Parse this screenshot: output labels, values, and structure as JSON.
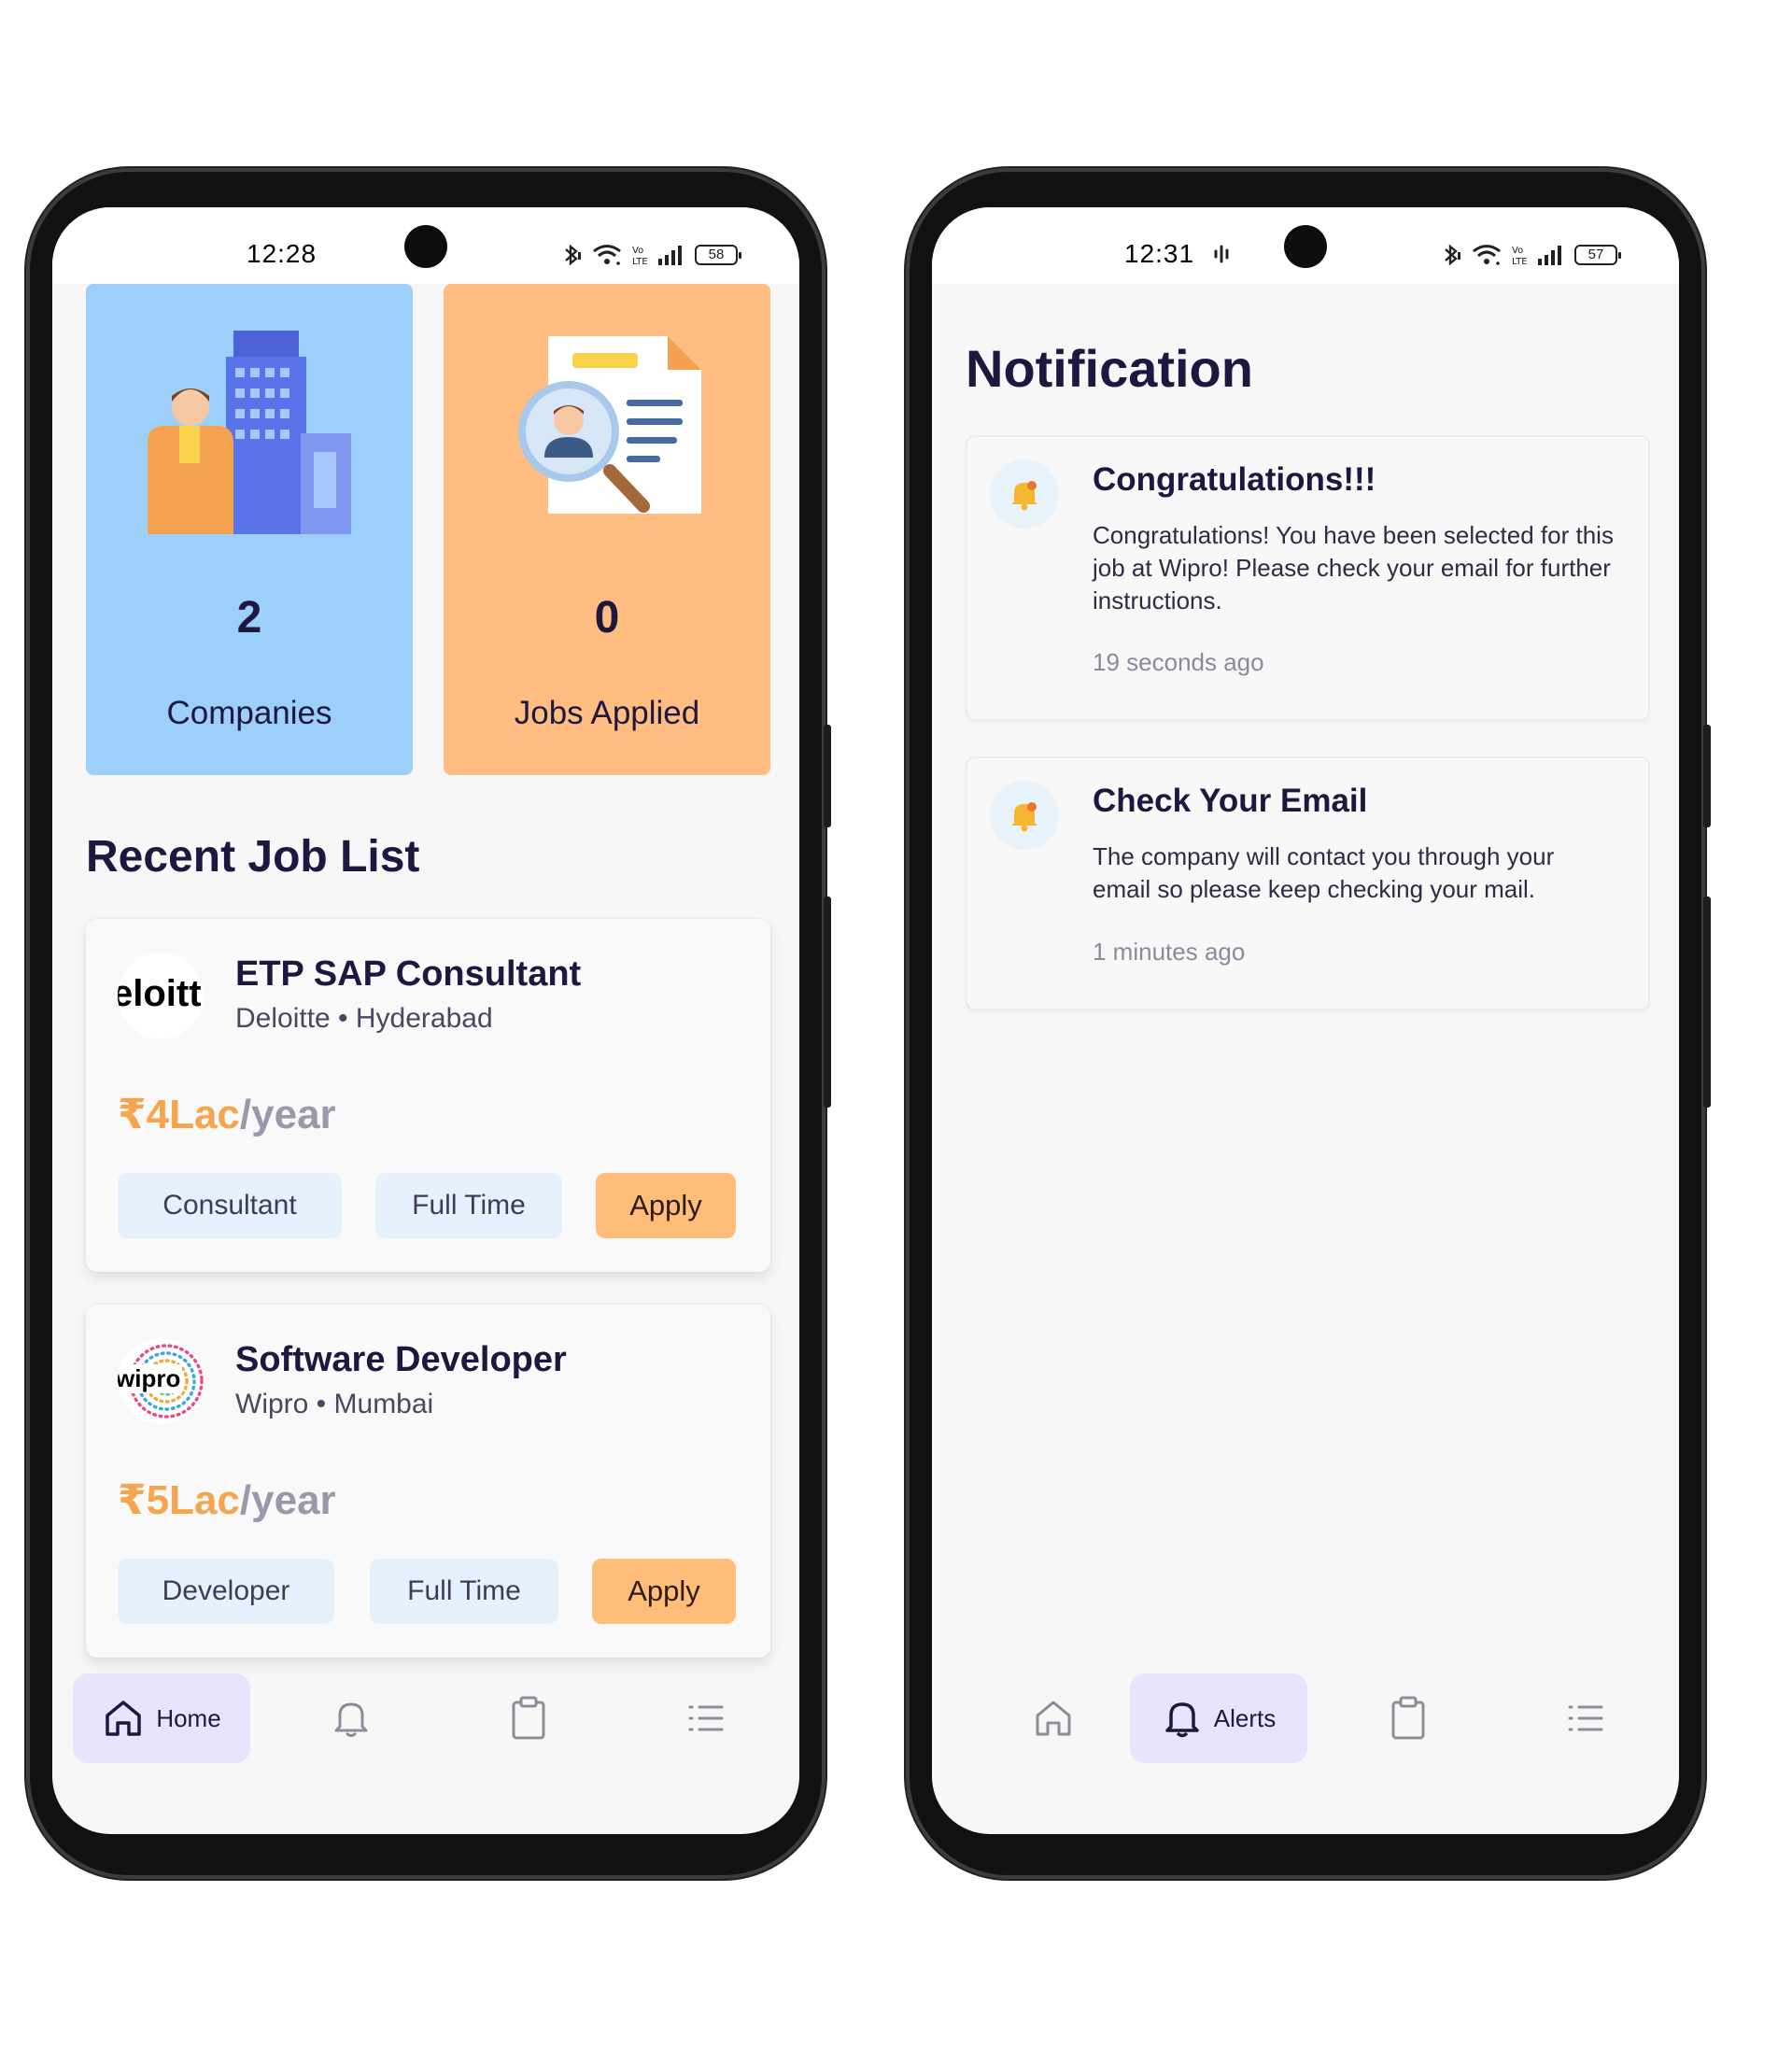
{
  "left_screen": {
    "status": {
      "time": "12:28",
      "battery": "58"
    },
    "stats": [
      {
        "number": "2",
        "label": "Companies"
      },
      {
        "number": "0",
        "label": "Jobs Applied"
      }
    ],
    "section_title": "Recent Job List",
    "jobs": [
      {
        "logo_text": "eloitt",
        "title": "ETP SAP Consultant",
        "meta": "Deloitte • Hyderabad",
        "salary_amount": "₹4Lac",
        "salary_period": "/year",
        "tags": [
          "Consultant",
          "Full Time"
        ],
        "apply_label": "Apply"
      },
      {
        "logo_text": "wipro",
        "title": "Software Developer",
        "meta": "Wipro • Mumbai",
        "salary_amount": "₹5Lac",
        "salary_period": "/year",
        "tags": [
          "Developer",
          "Full Time"
        ],
        "apply_label": "Apply"
      }
    ],
    "nav": {
      "active_label": "Home"
    }
  },
  "right_screen": {
    "status": {
      "time": "12:31",
      "battery": "57"
    },
    "title": "Notification",
    "notifications": [
      {
        "title": "Congratulations!!!",
        "body": "Congratulations! You have been selected for this job at Wipro! Please check your email for further instructions.",
        "time": "19 seconds ago"
      },
      {
        "title": "Check Your Email",
        "body": "The company will contact you through your email so please keep checking your mail.",
        "time": "1 minutes ago"
      }
    ],
    "nav": {
      "active_label": "Alerts"
    }
  },
  "icons": [
    "home-icon",
    "bell-icon",
    "clipboard-icon",
    "list-icon",
    "bluetooth-icon",
    "wifi-icon",
    "signal-icon",
    "battery-icon"
  ],
  "colors": {
    "companies_card": "#9ccff9",
    "jobs_card": "#ffbd82",
    "apply_button": "#ffbd79",
    "salary_amount": "#f6a54e",
    "nav_active": "#e9e4fd",
    "text_primary": "#1c1840"
  }
}
